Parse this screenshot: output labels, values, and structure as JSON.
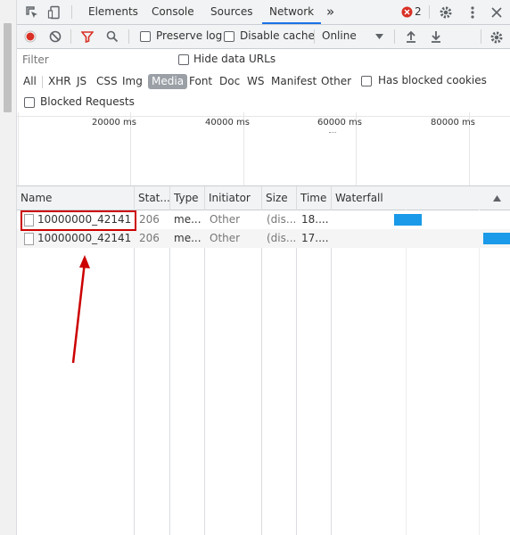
{
  "tabs": [
    "Elements",
    "Console",
    "Sources",
    "Network"
  ],
  "active_tab": "Network",
  "more_tabs": "»",
  "error_count": "2",
  "toolbar": {
    "preserve_log": "Preserve log",
    "disable_cache": "Disable cache",
    "throttle": "Online"
  },
  "filter": {
    "placeholder": "Filter",
    "hide_data_urls": "Hide data URLs",
    "types": [
      "All",
      "XHR",
      "JS",
      "CSS",
      "Img",
      "Media",
      "Font",
      "Doc",
      "WS",
      "Manifest",
      "Other"
    ],
    "selected_type": "Media",
    "has_blocked_cookies": "Has blocked cookies",
    "blocked_requests": "Blocked Requests"
  },
  "overview": {
    "ticks": [
      "20000 ms",
      "40000 ms",
      "60000 ms",
      "80000 ms"
    ]
  },
  "table": {
    "columns": [
      "Name",
      "Stat...",
      "Type",
      "Initiator",
      "Size",
      "Time",
      "Waterfall"
    ],
    "rows": [
      {
        "name": "10000000_42141...",
        "status": "206",
        "type": "me...",
        "initiator": "Other",
        "size": "(dis...",
        "time": "18...."
      },
      {
        "name": "10000000_42141...",
        "status": "206",
        "type": "me...",
        "initiator": "Other",
        "size": "(dis...",
        "time": "17...."
      }
    ]
  },
  "colors": {
    "accent": "#1a73e8",
    "record": "#d93025",
    "waterfall_bar": "#1a9ae8",
    "annotation": "#cc0000"
  }
}
